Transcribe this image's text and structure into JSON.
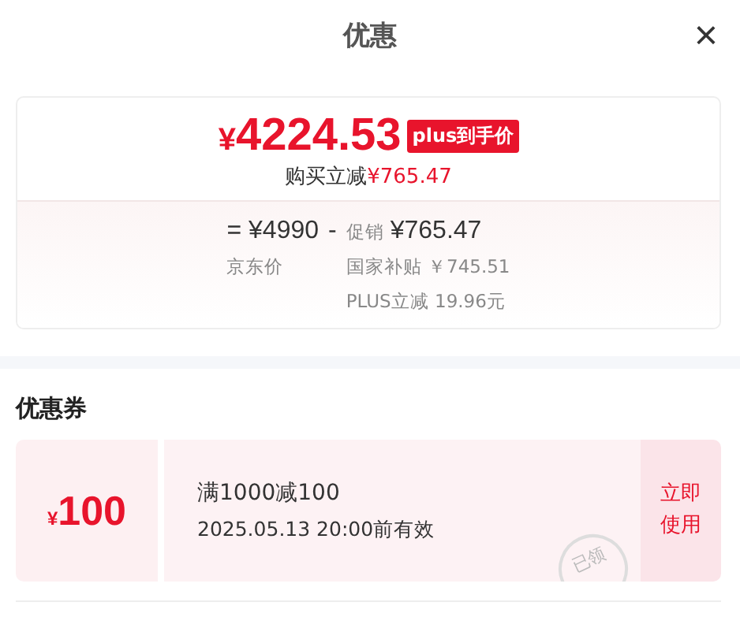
{
  "title": "优惠",
  "close": "×",
  "price": {
    "symbol": "¥",
    "amount": "4224.53",
    "badge": "plus到手价",
    "saving_label": "购买立减",
    "saving_value": "¥765.47"
  },
  "breakdown": {
    "equals": "=",
    "base_price": "¥4990",
    "base_label": "京东价",
    "minus": "-",
    "promo_label": "促销",
    "promo_value": "¥765.47",
    "details": [
      "国家补贴 ￥745.51",
      "PLUS立减 19.96元"
    ]
  },
  "coupons_heading": "优惠券",
  "coupons": [
    {
      "symbol": "¥",
      "amount": "100",
      "rule": "满1000减100",
      "validity": "2025.05.13 20:00前有效",
      "stamp": "已领",
      "action": "立即使用"
    }
  ]
}
